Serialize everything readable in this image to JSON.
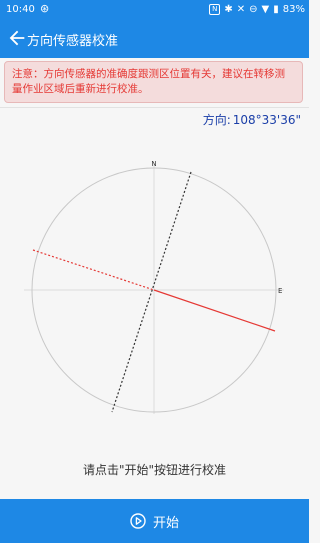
{
  "status_bar": {
    "time": "10:40",
    "nfc_label": "N",
    "battery": "83%",
    "icons": [
      "sync-icon",
      "nfc-icon",
      "bluetooth-icon",
      "mute-icon",
      "do-not-disturb-icon",
      "wifi-icon",
      "battery-icon"
    ]
  },
  "header": {
    "title": "方向传感器校准"
  },
  "notice": {
    "text": "注意：方向传感器的准确度跟测区位置有关，建议在转移测量作业区域后重新进行校准。"
  },
  "heading": {
    "prefix": "方向:",
    "value": "108°33'36\""
  },
  "compass": {
    "north_label": "N",
    "east_label": "E"
  },
  "hint": "请点击\"开始\"按钮进行校准",
  "start_button": {
    "label": "开始"
  },
  "colors": {
    "primary": "#1e88e5",
    "warning_text": "#e53935",
    "warning_bg": "#f4dcdc",
    "heading_text": "#1a3ea8",
    "east_line": "#e53935",
    "north_line": "#333333"
  }
}
